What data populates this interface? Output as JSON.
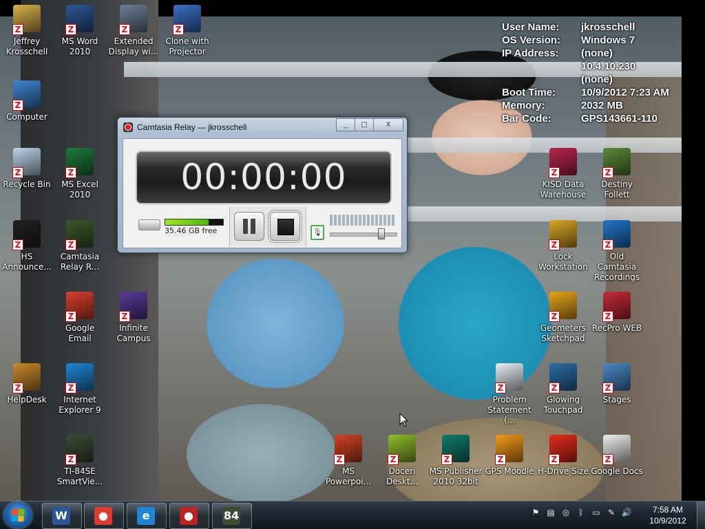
{
  "desktop_icons": [
    {
      "label": "Jeffrey Krosschell",
      "icon": "user-folder-icon",
      "color": "#d8b04a"
    },
    {
      "label": "MS Word 2010",
      "icon": "word-icon",
      "color": "#2b5797"
    },
    {
      "label": "Extended Display wi...",
      "icon": "display-icon",
      "color": "#6d7f95"
    },
    {
      "label": "Clone with Projector",
      "icon": "projector-icon",
      "color": "#3a6fc4"
    },
    {
      "label": "Computer",
      "icon": "computer-icon",
      "color": "#3f85d1"
    },
    {
      "label": "Recycle Bin",
      "icon": "recycle-bin-icon",
      "color": "#bcd4e8"
    },
    {
      "label": "MS Excel 2010",
      "icon": "excel-icon",
      "color": "#1f7a3c"
    },
    {
      "label": "HS Announce...",
      "icon": "announce-icon",
      "color": "#222222"
    },
    {
      "label": "Camtasia Relay R...",
      "icon": "camtasia-icon",
      "color": "#3c5a2c"
    },
    {
      "label": "Google Email",
      "icon": "gmail-icon",
      "color": "#d9402e"
    },
    {
      "label": "Infinite Campus",
      "icon": "campus-icon",
      "color": "#5a3b9b"
    },
    {
      "label": "HelpDesk",
      "icon": "helpdesk-icon",
      "color": "#c98a2a"
    },
    {
      "label": "Internet Explorer 9",
      "icon": "ie-icon",
      "color": "#1f86d6"
    },
    {
      "label": "TI-84SE SmartVie...",
      "icon": "calculator-icon",
      "color": "#3d4b35"
    },
    {
      "label": "MS Powerpoi...",
      "icon": "powerpoint-icon",
      "color": "#d04424"
    },
    {
      "label": "Doceri Deskt...",
      "icon": "doceri-icon",
      "color": "#8fbf2a"
    },
    {
      "label": "MS Publisher 2010 32bit",
      "icon": "publisher-icon",
      "color": "#0f7b6c"
    },
    {
      "label": "GPS Moodle",
      "icon": "moodle-icon",
      "color": "#f19a1a"
    },
    {
      "label": "H-Drive Size",
      "icon": "pie-chart-icon",
      "color": "#e42d1c"
    },
    {
      "label": "Google Docs",
      "icon": "docs-icon",
      "color": "#f0f0f0"
    },
    {
      "label": "KISD Data Warehouse",
      "icon": "data-warehouse-icon",
      "color": "#b8264d"
    },
    {
      "label": "Destiny Follett",
      "icon": "tree-icon",
      "color": "#5b8a3a"
    },
    {
      "label": "Lock Workstation",
      "icon": "lock-icon",
      "color": "#d9a523"
    },
    {
      "label": "Old Camtasia Recordings",
      "icon": "globe-icon",
      "color": "#2376c9"
    },
    {
      "label": "Geometers Sketchpad",
      "icon": "sketchpad-icon",
      "color": "#e8a51a"
    },
    {
      "label": "RecPro WEB",
      "icon": "recpro-icon",
      "color": "#c42a3a"
    },
    {
      "label": "Problem Statement (...",
      "icon": "document-icon",
      "color": "#eaeef5"
    },
    {
      "label": "Glowing Touchpad",
      "icon": "touchpad-icon",
      "color": "#2c6fa8"
    },
    {
      "label": "Stages",
      "icon": "stages-icon",
      "color": "#4a88c7"
    }
  ],
  "sysinfo": [
    {
      "key": "User Name:",
      "value": "jkrosschell"
    },
    {
      "key": "OS Version:",
      "value": "Windows 7"
    },
    {
      "key": "IP Address:",
      "value": "(none)"
    },
    {
      "key": "",
      "value": "10.4.10.230"
    },
    {
      "key": "",
      "value": "(none)"
    },
    {
      "key": "Boot Time:",
      "value": "10/9/2012 7:23 AM"
    },
    {
      "key": "Memory:",
      "value": "2032 MB"
    },
    {
      "key": "Bar Code:",
      "value": "GPS143661-110"
    }
  ],
  "camtasia": {
    "title": "Camtasia Relay — jkrosschell",
    "timer": "00:00:00",
    "disk_free": "35.46 GB free",
    "disk_fill_percent": 75,
    "volume_level": 0.78,
    "min_symbol": "_",
    "max_symbol": "□",
    "close_symbol": "X",
    "mic_symbol": "🎙"
  },
  "taskbar": {
    "buttons": [
      {
        "name": "word",
        "glyph": "W",
        "color": "#2b5797"
      },
      {
        "name": "chrome",
        "glyph": "●",
        "color": "#e03b2e"
      },
      {
        "name": "internet-explorer",
        "glyph": "e",
        "color": "#1f86d6"
      },
      {
        "name": "camtasia-relay",
        "glyph": "●",
        "color": "#b22"
      },
      {
        "name": "ti-84-smartview",
        "glyph": "84",
        "color": "#3d4b35"
      }
    ],
    "tray_icons": [
      "flag-icon",
      "network-icon",
      "sync-icon",
      "bluetooth-icon",
      "display-icon",
      "tools-icon",
      "volume-icon"
    ],
    "clock_time": "7:58 AM",
    "clock_date": "10/9/2012"
  }
}
